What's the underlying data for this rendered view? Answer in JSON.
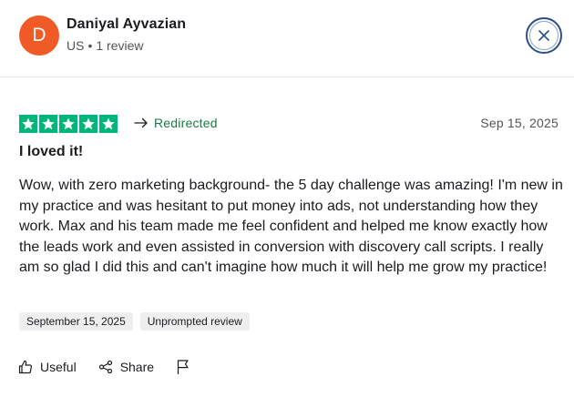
{
  "reviewer": {
    "initial": "D",
    "name": "Daniyal Ayvazian",
    "country": "US",
    "separator": "•",
    "review_count": "1 review",
    "avatar_color": "#f05a26"
  },
  "review": {
    "rating": 5,
    "max_rating": 5,
    "star_color": "#00b67a",
    "source_label": "Redirected",
    "date": "Sep 15, 2025",
    "title": "I loved it!",
    "text": "Wow, with zero marketing background- the 5 day challenge was amazing! I'm new in my practice and was hesitant to put money into ads, not understanding how they work. Max and his team made me feel confident and helped me know exactly how the leads work and even assisted in conversion with discovery call scripts. I really am so glad I did this and can't imagine how much it will help me grow my practice!",
    "tags": [
      "September 15, 2025",
      "Unprompted review"
    ]
  },
  "actions": {
    "useful_label": "Useful",
    "share_label": "Share"
  },
  "icons": {
    "close": "close-icon",
    "redirect": "arrow-right-icon",
    "useful": "thumbs-up-icon",
    "share": "share-icon",
    "flag": "flag-icon",
    "star": "star-icon"
  }
}
